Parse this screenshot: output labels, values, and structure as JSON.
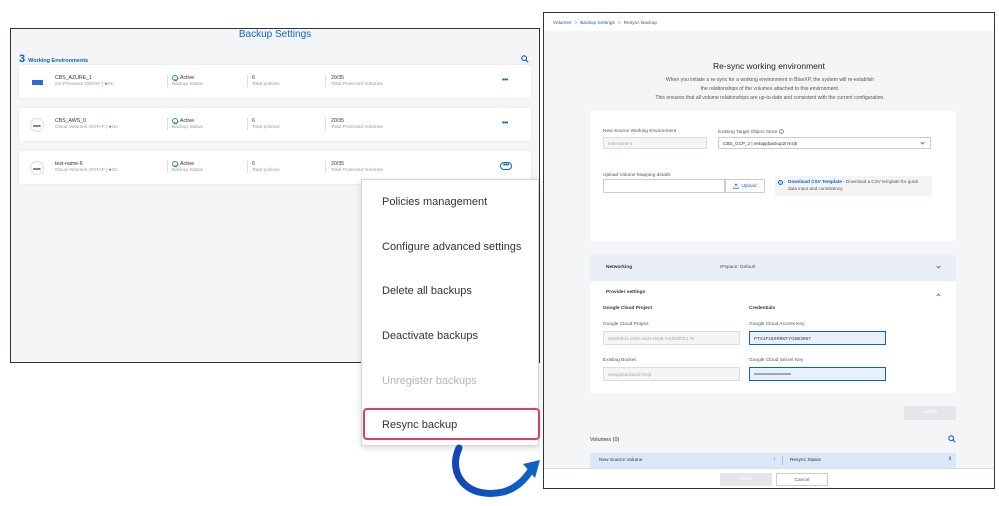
{
  "backup_settings": {
    "title": "Backup Settings",
    "env_count": "3",
    "env_label": "Working Environments",
    "environments": [
      {
        "name": "CBS_AZURE_1",
        "type": "On-Premises ONTAP",
        "state": "On",
        "logo": "azure",
        "status_value": "Active",
        "status_caption": "Backup Status",
        "policies_value": "6",
        "policies_caption": "Total policies",
        "volumes_value": "20/35",
        "volumes_caption": "Total Protected Volumes"
      },
      {
        "name": "CBS_AWS_0",
        "type": "Cloud Volumes ONTAP",
        "state": "On",
        "logo": "aws",
        "status_value": "Active",
        "status_caption": "Backup Status",
        "policies_value": "6",
        "policies_caption": "Total policies",
        "volumes_value": "20/35",
        "volumes_caption": "Total Protected Volumes"
      },
      {
        "name": "test-name-6",
        "type": "Cloud Volumes ONTAP",
        "state": "On",
        "logo": "aws",
        "status_value": "Active",
        "status_caption": "Backup Status",
        "policies_value": "6",
        "policies_caption": "Total policies",
        "volumes_value": "20/35",
        "volumes_caption": "Total Protected Volumes"
      }
    ],
    "more_glyph": "•••",
    "separator": "|",
    "on_dot": "●"
  },
  "menu": {
    "items": [
      "Policies management",
      "Configure advanced settings",
      "Delete all backups",
      "Deactivate backups",
      "Unregister backups",
      "Resync backup"
    ]
  },
  "resync": {
    "breadcrumb": {
      "volumes": "Volumes",
      "backup_settings": "Backup Settings",
      "current": "Resync Backup",
      "sep": ">"
    },
    "title": "Re-sync working environment",
    "desc_lines": [
      "When you initiate a re-sync for a working environment in BlueXP, the system will re-establish",
      "the relationships of the volumes attached to this environment.",
      "This ensures that all volume relationships are up-to-date and consistent with the current configuration."
    ],
    "source_label": "New Source Working Environment",
    "source_value": "test-name-6",
    "target_label": "Existing Target Object Store",
    "target_value": "CBS_GCP_2 | netappbackup2i7ezj5",
    "mapping_label": "Upload Volume Mapping details",
    "upload_label": "Upload",
    "csv_link": "Download CSV Template",
    "csv_text_1": " - Download a CSV template for quick",
    "csv_text_2": "data input and consistency.",
    "networking_label": "Networking",
    "ipspace_label": "IPspace: Default",
    "provider_label": "Provider settings",
    "gcp_project_heading": "Google Cloud Project",
    "credentials_heading": "Credentials",
    "gcp_project_label": "Google Cloud Project",
    "gcp_project_value": "0e5386d1-e69c-4ad1-84a6-34dbd0f3c178",
    "access_key_label": "Google Cloud Access Key",
    "access_key_value": "PTX1F15XR9KFYGB53957",
    "bucket_label": "Existing Bucket",
    "bucket_value": "netappbackup2i7ezj5",
    "secret_key_label": "Google Cloud Secret Key",
    "secret_key_value": "••••••••••••••••••••••••••••••••••••••••",
    "submit_label": "Submit",
    "volumes_title": "Volumes (0)",
    "col_source": "New Source Volume",
    "col_status": "Resync Status",
    "done_label": "Done",
    "cancel_label": "Cancel"
  }
}
